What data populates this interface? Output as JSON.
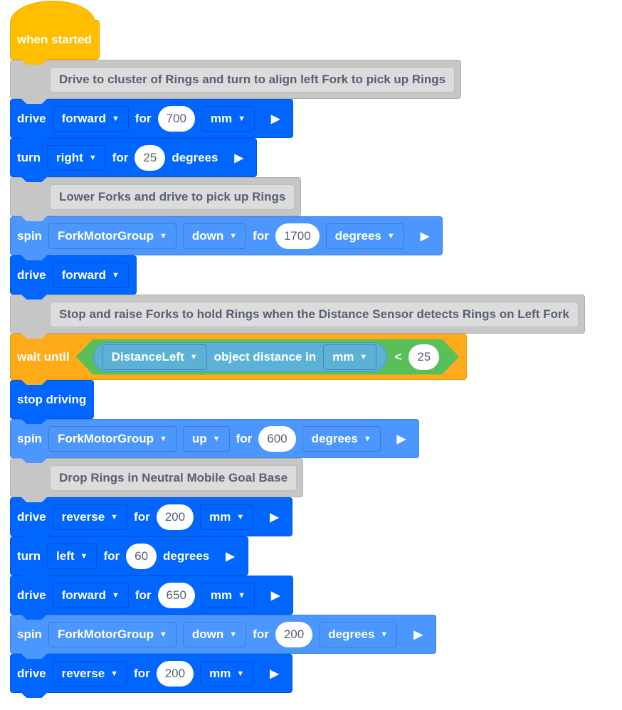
{
  "colors": {
    "drivetrain": "#0066ff",
    "motion": "#4c97ff",
    "events": "#ffbf00",
    "control": "#ffab19",
    "operators": "#59c059",
    "sensing": "#5cb1d6",
    "comment": "#c6c6c6"
  },
  "blocks": [
    {
      "kind": "event",
      "name": "when-started-block",
      "parts": [
        {
          "t": "label",
          "v": "when started"
        }
      ]
    },
    {
      "kind": "comment",
      "name": "comment-block",
      "parts": [
        {
          "t": "ctext",
          "v": "Drive to cluster of Rings and turn to align left Fork to pick up Rings"
        }
      ]
    },
    {
      "kind": "drive",
      "name": "drive-for-block",
      "parts": [
        {
          "t": "label",
          "v": "drive"
        },
        {
          "t": "dd",
          "v": "forward"
        },
        {
          "t": "label",
          "v": "for"
        },
        {
          "t": "num",
          "v": "700"
        },
        {
          "t": "dd",
          "v": "mm"
        },
        {
          "t": "play"
        }
      ]
    },
    {
      "kind": "drive",
      "name": "turn-for-block",
      "parts": [
        {
          "t": "label",
          "v": "turn"
        },
        {
          "t": "dd",
          "v": "right"
        },
        {
          "t": "label",
          "v": "for"
        },
        {
          "t": "num",
          "v": "25"
        },
        {
          "t": "label",
          "v": "degrees"
        },
        {
          "t": "play"
        }
      ]
    },
    {
      "kind": "comment",
      "name": "comment-block",
      "parts": [
        {
          "t": "ctext",
          "v": "Lower Forks and drive to pick up Rings"
        }
      ]
    },
    {
      "kind": "motor",
      "name": "spin-for-block",
      "parts": [
        {
          "t": "label",
          "v": "spin"
        },
        {
          "t": "dd",
          "v": "ForkMotorGroup"
        },
        {
          "t": "dd",
          "v": "down"
        },
        {
          "t": "label",
          "v": "for"
        },
        {
          "t": "num",
          "v": "1700"
        },
        {
          "t": "dd",
          "v": "degrees"
        },
        {
          "t": "play"
        }
      ]
    },
    {
      "kind": "drive",
      "name": "drive-block",
      "parts": [
        {
          "t": "label",
          "v": "drive"
        },
        {
          "t": "dd",
          "v": "forward"
        }
      ]
    },
    {
      "kind": "comment",
      "name": "comment-block",
      "parts": [
        {
          "t": "ctext",
          "v": "Stop and raise Forks to hold Rings when the Distance Sensor detects Rings on Left Fork"
        }
      ]
    },
    {
      "kind": "control",
      "name": "wait-until-block",
      "parts": [
        {
          "t": "label",
          "v": "wait until"
        },
        {
          "t": "cond",
          "sensor": "DistanceLeft",
          "text": "object distance in",
          "unit": "mm",
          "op": "<",
          "value": "25"
        }
      ]
    },
    {
      "kind": "drive",
      "name": "stop-driving-block",
      "parts": [
        {
          "t": "label",
          "v": "stop driving"
        }
      ]
    },
    {
      "kind": "motor",
      "name": "spin-for-block",
      "parts": [
        {
          "t": "label",
          "v": "spin"
        },
        {
          "t": "dd",
          "v": "ForkMotorGroup"
        },
        {
          "t": "dd",
          "v": "up"
        },
        {
          "t": "label",
          "v": "for"
        },
        {
          "t": "num",
          "v": "600"
        },
        {
          "t": "dd",
          "v": "degrees"
        },
        {
          "t": "play"
        }
      ]
    },
    {
      "kind": "comment",
      "name": "comment-block",
      "parts": [
        {
          "t": "ctext",
          "v": "Drop Rings in Neutral Mobile Goal Base"
        }
      ]
    },
    {
      "kind": "drive",
      "name": "drive-for-block",
      "parts": [
        {
          "t": "label",
          "v": "drive"
        },
        {
          "t": "dd",
          "v": "reverse"
        },
        {
          "t": "label",
          "v": "for"
        },
        {
          "t": "num",
          "v": "200"
        },
        {
          "t": "dd",
          "v": "mm"
        },
        {
          "t": "play"
        }
      ]
    },
    {
      "kind": "drive",
      "name": "turn-for-block",
      "parts": [
        {
          "t": "label",
          "v": "turn"
        },
        {
          "t": "dd",
          "v": "left"
        },
        {
          "t": "label",
          "v": "for"
        },
        {
          "t": "num",
          "v": "60"
        },
        {
          "t": "label",
          "v": "degrees"
        },
        {
          "t": "play"
        }
      ]
    },
    {
      "kind": "drive",
      "name": "drive-for-block",
      "parts": [
        {
          "t": "label",
          "v": "drive"
        },
        {
          "t": "dd",
          "v": "forward"
        },
        {
          "t": "label",
          "v": "for"
        },
        {
          "t": "num",
          "v": "650"
        },
        {
          "t": "dd",
          "v": "mm"
        },
        {
          "t": "play"
        }
      ]
    },
    {
      "kind": "motor",
      "name": "spin-for-block",
      "parts": [
        {
          "t": "label",
          "v": "spin"
        },
        {
          "t": "dd",
          "v": "ForkMotorGroup"
        },
        {
          "t": "dd",
          "v": "down"
        },
        {
          "t": "label",
          "v": "for"
        },
        {
          "t": "num",
          "v": "200"
        },
        {
          "t": "dd",
          "v": "degrees"
        },
        {
          "t": "play"
        }
      ]
    },
    {
      "kind": "drive",
      "name": "drive-for-block",
      "parts": [
        {
          "t": "label",
          "v": "drive"
        },
        {
          "t": "dd",
          "v": "reverse"
        },
        {
          "t": "label",
          "v": "for"
        },
        {
          "t": "num",
          "v": "200"
        },
        {
          "t": "dd",
          "v": "mm"
        },
        {
          "t": "play"
        }
      ]
    }
  ]
}
